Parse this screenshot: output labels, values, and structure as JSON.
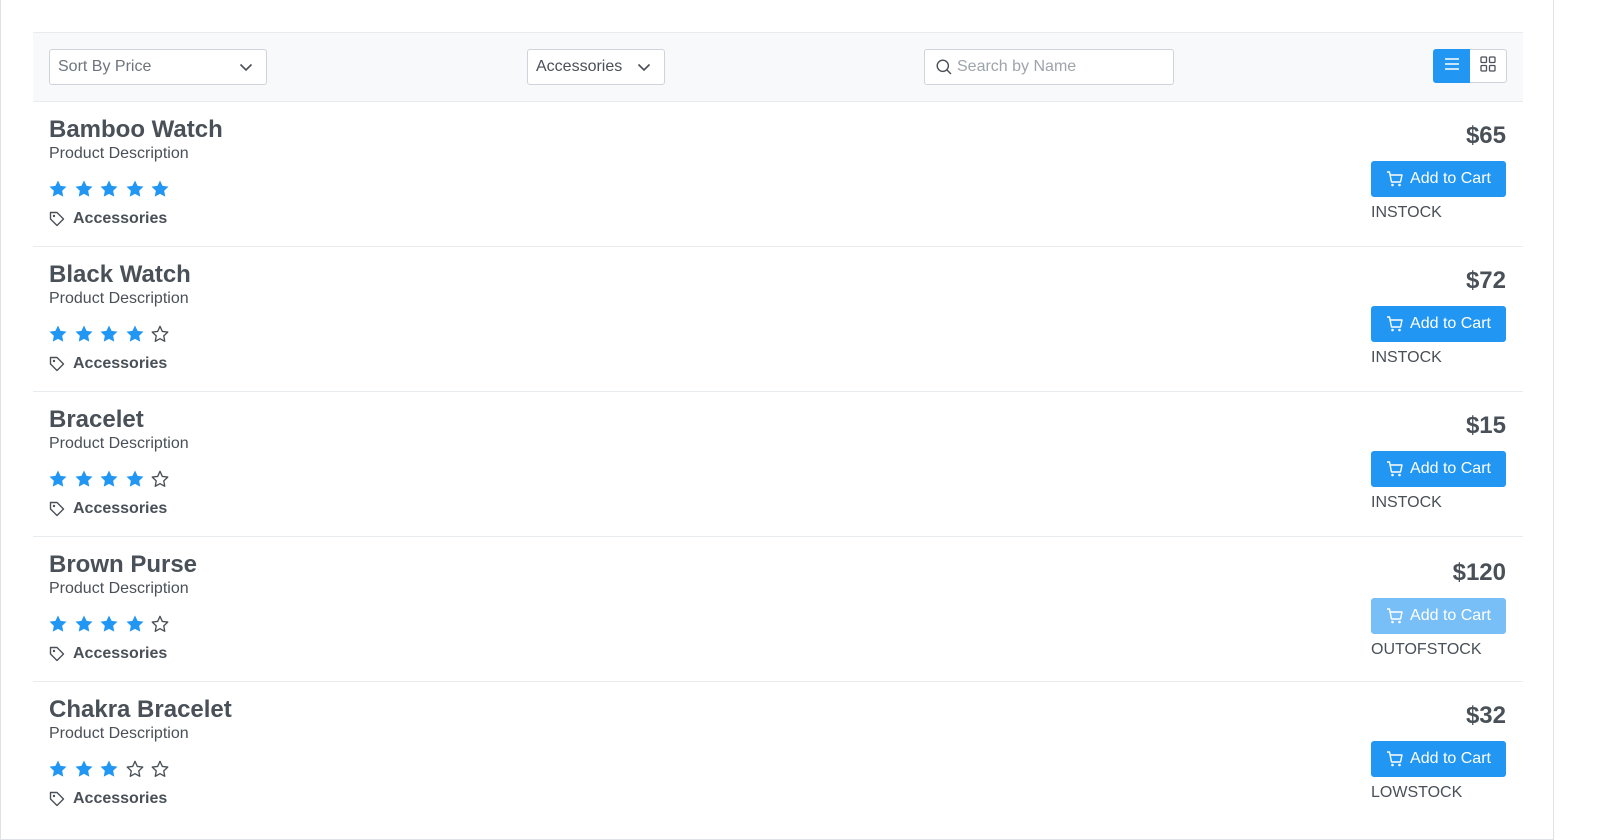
{
  "toolbar": {
    "sort_label": "Sort By Price",
    "category_label": "Accessories",
    "search_placeholder": "Search by Name",
    "layout": "list"
  },
  "colors": {
    "primary": "#2196f3",
    "text": "#495057",
    "border": "#dee2e6",
    "header_bg": "#f8f9fa"
  },
  "products": [
    {
      "name": "Bamboo Watch",
      "description": "Product Description",
      "rating": 5,
      "category": "Accessories",
      "price": "$65",
      "button": "Add to Cart",
      "status": "INSTOCK",
      "disabled": false
    },
    {
      "name": "Black Watch",
      "description": "Product Description",
      "rating": 4,
      "category": "Accessories",
      "price": "$72",
      "button": "Add to Cart",
      "status": "INSTOCK",
      "disabled": false
    },
    {
      "name": "Bracelet",
      "description": "Product Description",
      "rating": 4,
      "category": "Accessories",
      "price": "$15",
      "button": "Add to Cart",
      "status": "INSTOCK",
      "disabled": false
    },
    {
      "name": "Brown Purse",
      "description": "Product Description",
      "rating": 4,
      "category": "Accessories",
      "price": "$120",
      "button": "Add to Cart",
      "status": "OUTOFSTOCK",
      "disabled": true
    },
    {
      "name": "Chakra Bracelet",
      "description": "Product Description",
      "rating": 3,
      "category": "Accessories",
      "price": "$32",
      "button": "Add to Cart",
      "status": "LOWSTOCK",
      "disabled": false
    }
  ]
}
